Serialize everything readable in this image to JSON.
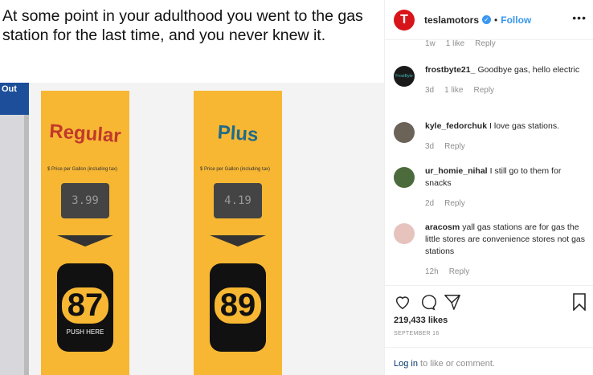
{
  "post": {
    "caption": "At some point in your adulthood you went to the gas station for the last time, and you never knew it.",
    "photo": {
      "grades": [
        {
          "name": "Regular",
          "octane": "87",
          "price_label": "$ Price per Gallon (including tax)",
          "display": "3.99",
          "button": "PUSH HERE"
        },
        {
          "name": "Plus",
          "octane": "89",
          "price_label": "$ Price per Gallon (including tax)",
          "display": "4.19"
        }
      ],
      "corner_sign": "Out"
    }
  },
  "header": {
    "username": "teslamotors",
    "separator": "•",
    "follow_label": "Follow",
    "more": "•••",
    "avatar_letter": "T"
  },
  "partial_comment": {
    "time": "1w",
    "likes": "1 like",
    "reply": "Reply"
  },
  "comments": [
    {
      "user": "frostbyte21_",
      "text": "Goodbye gas, hello electric",
      "time": "3d",
      "likes": "1 like",
      "reply": "Reply",
      "avatar_color": "#1a1a1a"
    },
    {
      "user": "kyle_fedorchuk",
      "text": "I love gas stations.",
      "time": "3d",
      "likes": "",
      "reply": "Reply",
      "avatar_color": "#6b6258"
    },
    {
      "user": "ur_homie_nihal",
      "text": "I still go to them for snacks",
      "time": "2d",
      "likes": "",
      "reply": "Reply",
      "avatar_color": "#4c6b3c"
    },
    {
      "user": "aracosm",
      "text": "yall gas stations are for gas the little stores are convenience stores not gas stations",
      "time": "12h",
      "likes": "",
      "reply": "Reply",
      "avatar_color": "#e7c3bd"
    }
  ],
  "actions": {
    "likes": "219,433 likes",
    "date": "SEPTEMBER 16"
  },
  "login": {
    "link": "Log in",
    "rest": " to like or comment."
  }
}
